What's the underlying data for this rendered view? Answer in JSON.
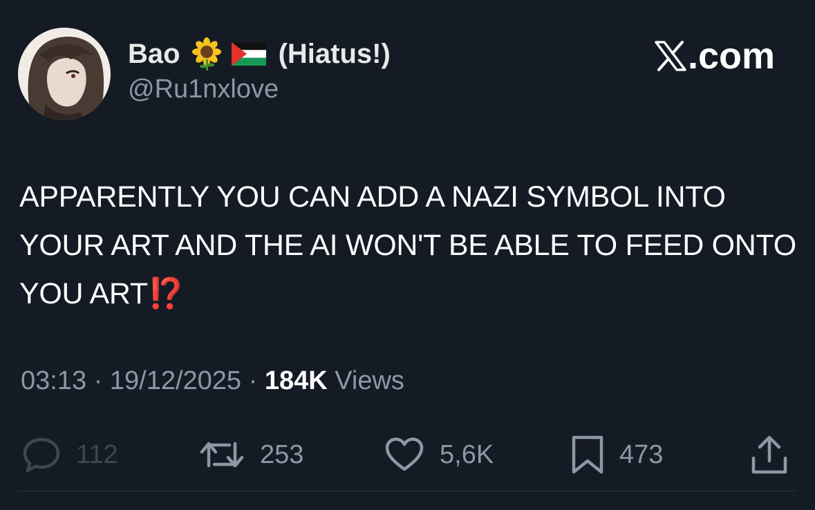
{
  "author": {
    "display_name": "Bao",
    "name_suffix": "(Hiatus!)",
    "handle": "@Ru1nxlove",
    "name_icons": [
      "sunflower-emoji",
      "palestine-flag-emoji"
    ]
  },
  "brand": {
    "label": ".com",
    "icon": "x-logo"
  },
  "tweet": {
    "text": "APPARENTLY YOU CAN ADD A NAZI SYMBOL INTO YOUR ART AND THE AI WON'T BE ABLE TO FEED ONTO YOU ART",
    "trailing_emoji": "⁉️"
  },
  "meta": {
    "time": "03:13",
    "separator": "·",
    "date": "19/12/2025",
    "views_count": "184K",
    "views_label": "Views"
  },
  "actions": {
    "replies": "112",
    "reposts": "253",
    "likes": "5,6K",
    "bookmarks": "473"
  },
  "colors": {
    "background": "#151b24",
    "text": "#ffffff",
    "secondary_text": "#8b98a5",
    "emoji_red": "#e0332a"
  }
}
